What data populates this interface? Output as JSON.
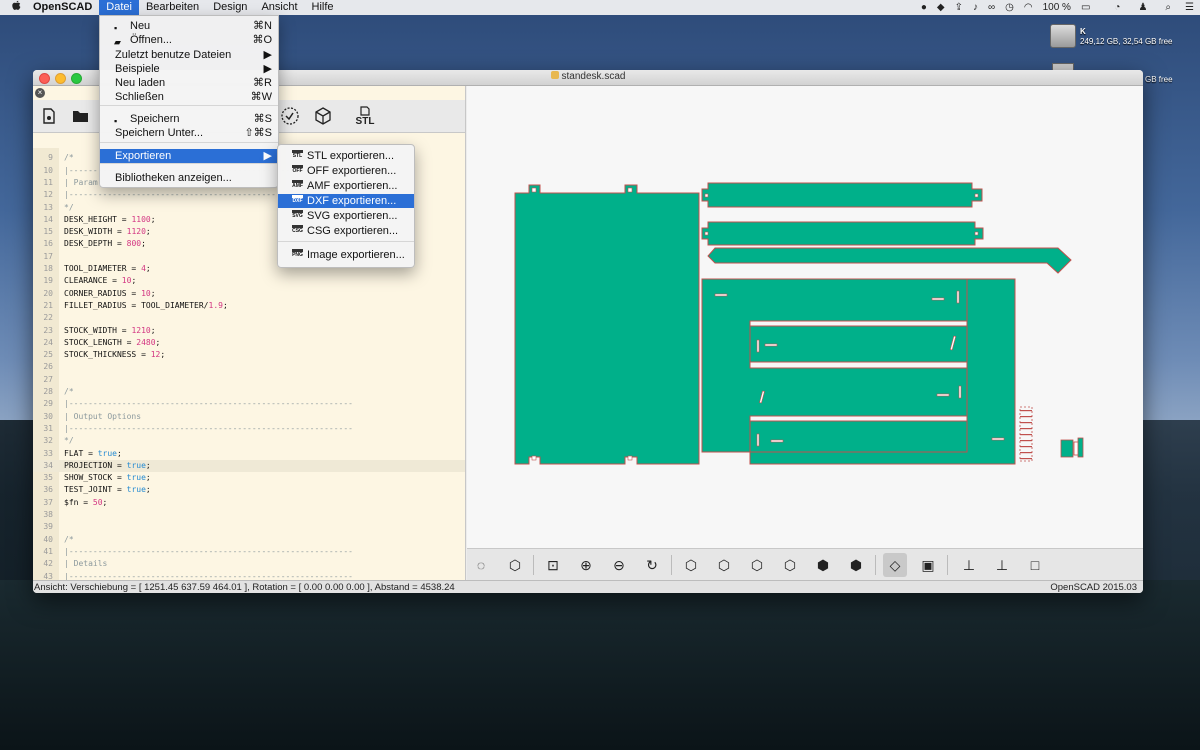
{
  "menubar": {
    "apple": "",
    "app": "OpenSCAD",
    "items": [
      "Datei",
      "Bearbeiten",
      "Design",
      "Ansicht",
      "Hilfe"
    ],
    "status_right": [
      "100 %"
    ]
  },
  "desktop": {
    "drive_name": "K",
    "drive_info": "249,12 GB, 32,54 GB free",
    "drive2_info": "GB free"
  },
  "window": {
    "title": "standesk.scad",
    "status_left": "Ansicht: Verschiebung = [ 1251.45 637.59 464.01 ], Rotation = [ 0.00 0.00 0.00 ], Abstand = 4538.24",
    "status_right": "OpenSCAD 2015.03"
  },
  "editor_toolbar": {
    "stl_label": "STL"
  },
  "code_lines": [
    {
      "n": "8",
      "t": ""
    },
    {
      "n": "9",
      "t": "/*"
    },
    {
      "n": "10",
      "t": "|-----------------------------------------------------------"
    },
    {
      "n": "11",
      "t": "| Param"
    },
    {
      "n": "12",
      "t": "|-----------------------------------------------------------"
    },
    {
      "n": "13",
      "t": "*/"
    },
    {
      "n": "14",
      "t": "DESK_HEIGHT = 1100;"
    },
    {
      "n": "15",
      "t": "DESK_WIDTH = 1120;"
    },
    {
      "n": "16",
      "t": "DESK_DEPTH = 800;"
    },
    {
      "n": "17",
      "t": ""
    },
    {
      "n": "18",
      "t": "TOOL_DIAMETER = 4;"
    },
    {
      "n": "19",
      "t": "CLEARANCE = 10;"
    },
    {
      "n": "20",
      "t": "CORNER_RADIUS = 10;"
    },
    {
      "n": "21",
      "t": "FILLET_RADIUS = TOOL_DIAMETER/1.9;"
    },
    {
      "n": "22",
      "t": ""
    },
    {
      "n": "23",
      "t": "STOCK_WIDTH = 1210;"
    },
    {
      "n": "24",
      "t": "STOCK_LENGTH = 2480;"
    },
    {
      "n": "25",
      "t": "STOCK_THICKNESS = 12;"
    },
    {
      "n": "26",
      "t": ""
    },
    {
      "n": "27",
      "t": ""
    },
    {
      "n": "28",
      "t": "/*"
    },
    {
      "n": "29",
      "t": "|-----------------------------------------------------------"
    },
    {
      "n": "30",
      "t": "| Output Options"
    },
    {
      "n": "31",
      "t": "|-----------------------------------------------------------"
    },
    {
      "n": "32",
      "t": "*/"
    },
    {
      "n": "33",
      "t": "FLAT = true;"
    },
    {
      "n": "34",
      "t": "PROJECTION = true;"
    },
    {
      "n": "35",
      "t": "SHOW_STOCK = true;"
    },
    {
      "n": "36",
      "t": "TEST_JOINT = true;"
    },
    {
      "n": "37",
      "t": "$fn = 50;"
    },
    {
      "n": "38",
      "t": ""
    },
    {
      "n": "39",
      "t": ""
    },
    {
      "n": "40",
      "t": "/*"
    },
    {
      "n": "41",
      "t": "|-----------------------------------------------------------"
    },
    {
      "n": "42",
      "t": "| Details"
    },
    {
      "n": "43",
      "t": "|-----------------------------------------------------------"
    },
    {
      "n": "44",
      "t": "*/"
    }
  ],
  "file_menu": [
    {
      "label": "Neu",
      "key": "⌘N",
      "icon": "new-file-icon"
    },
    {
      "label": "Öffnen...",
      "key": "⌘O",
      "icon": "folder-open-icon"
    },
    {
      "label": "Zuletzt benutze Dateien",
      "key": "▶"
    },
    {
      "label": "Beispiele",
      "key": "▶"
    },
    {
      "label": "Neu laden",
      "key": "⌘R"
    },
    {
      "label": "Schließen",
      "key": "⌘W"
    },
    {
      "label": "Speichern",
      "key": "⌘S",
      "icon": "save-icon"
    },
    {
      "label": "Speichern Unter...",
      "key": "⇧⌘S"
    },
    {
      "label": "Exportieren",
      "key": "▶"
    },
    {
      "label": "Bibliotheken anzeigen..."
    }
  ],
  "export_menu": [
    {
      "label": "STL exportieren...",
      "badge": "STL"
    },
    {
      "label": "OFF exportieren...",
      "badge": "OFF"
    },
    {
      "label": "AMF exportieren...",
      "badge": "AMF"
    },
    {
      "label": "DXF exportieren...",
      "badge": "DXF"
    },
    {
      "label": "SVG exportieren...",
      "badge": "SVG"
    },
    {
      "label": "CSG exportieren...",
      "badge": "CSG"
    },
    {
      "label": "Image exportieren...",
      "badge": "PNG"
    }
  ],
  "colors": {
    "accent": "#2b6fd6",
    "part_fill": "#00b08a",
    "part_stroke": "#c0504d"
  }
}
